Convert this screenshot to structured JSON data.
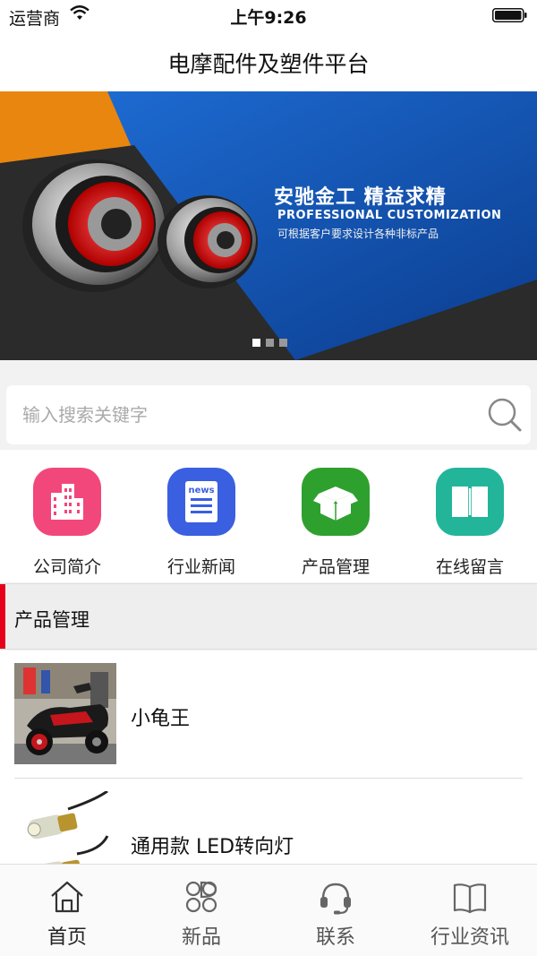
{
  "status_bar": {
    "carrier": "运营商",
    "time": "上午9:26"
  },
  "nav": {
    "title": "电摩配件及塑件平台"
  },
  "banner": {
    "headline": "安驰金工  精益求精",
    "subtitle": "PROFESSIONAL CUSTOMIZATION",
    "description": "可根据客户要求设计各种非标产品",
    "slide_count": 3,
    "active_slide": 1
  },
  "search": {
    "placeholder": "输入搜索关键字",
    "value": ""
  },
  "quick_menu": [
    {
      "label": "公司简介",
      "icon": "building-icon",
      "color": "#f2477b"
    },
    {
      "label": "行业新闻",
      "icon": "news-icon",
      "color": "#3a5fe0"
    },
    {
      "label": "产品管理",
      "icon": "box-icon",
      "color": "#2ea02e"
    },
    {
      "label": "在线留言",
      "icon": "book-icon",
      "color": "#22b59a"
    }
  ],
  "section": {
    "title": "产品管理",
    "accent_color": "#e5001c"
  },
  "products": [
    {
      "name": "小龟王",
      "thumb": "scooter-image"
    },
    {
      "name": "通用款 LED转向灯",
      "thumb": "turn-signal-image"
    }
  ],
  "tab_bar": [
    {
      "label": "首页",
      "icon": "home-icon",
      "active": true
    },
    {
      "label": "新品",
      "icon": "grid-icon",
      "active": false
    },
    {
      "label": "联系",
      "icon": "headset-icon",
      "active": false
    },
    {
      "label": "行业资讯",
      "icon": "book-icon",
      "active": false
    }
  ]
}
